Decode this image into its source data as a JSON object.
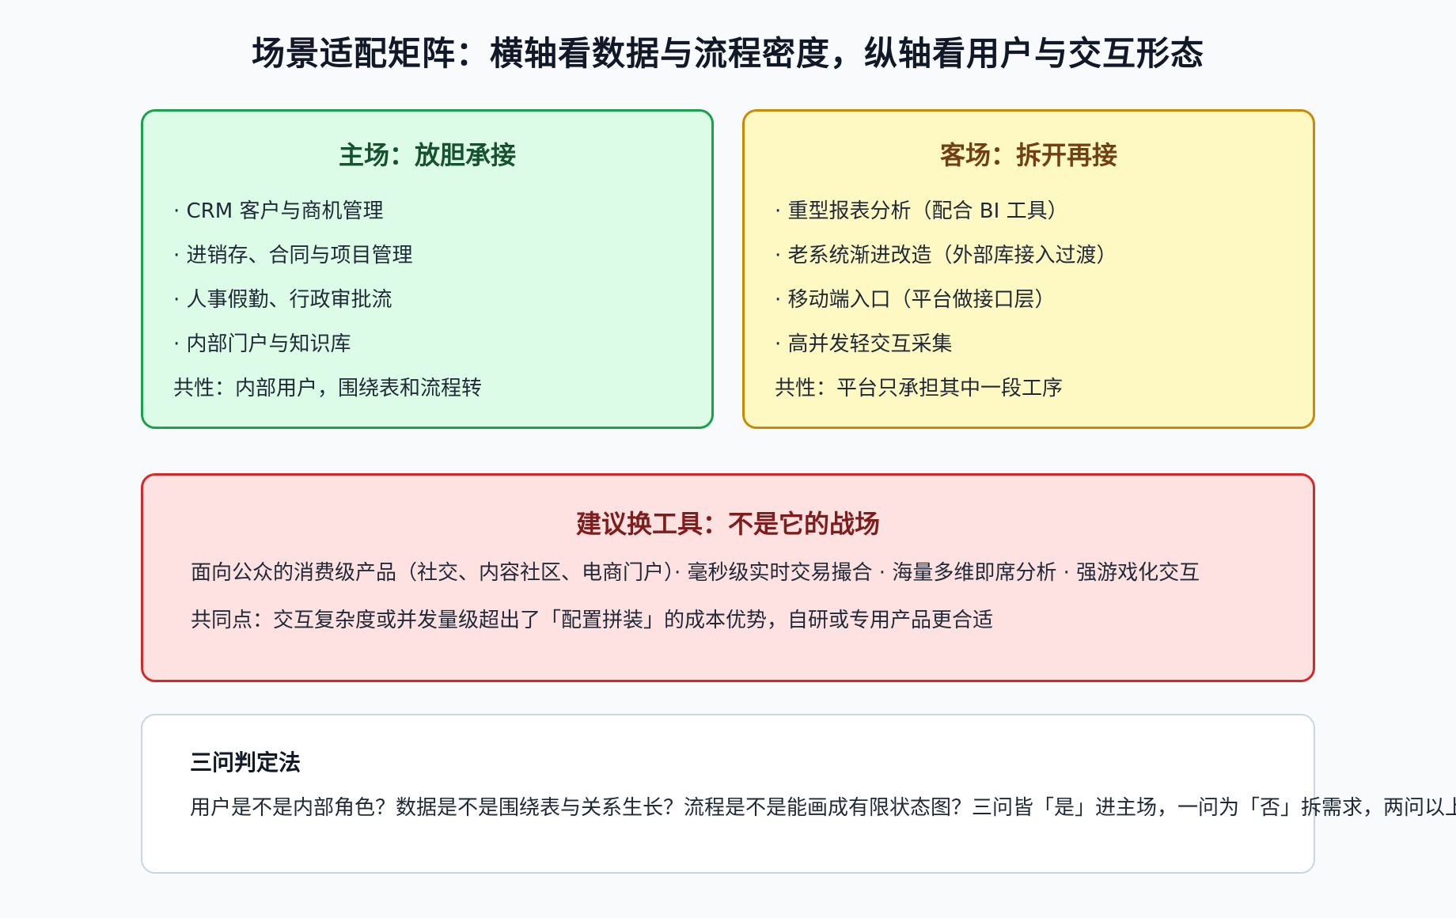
{
  "title": "场景适配矩阵：横轴看数据与流程密度，纵轴看用户与交互形态",
  "home": {
    "title": "主场：放胆承接",
    "items": [
      "· CRM 客户与商机管理",
      "· 进销存、合同与项目管理",
      "· 人事假勤、行政审批流",
      "· 内部门户与知识库"
    ],
    "summary": "共性：内部用户，围绕表和流程转"
  },
  "away": {
    "title": "客场：拆开再接",
    "items": [
      "· 重型报表分析（配合 BI 工具）",
      "· 老系统渐进改造（外部库接入过渡）",
      "· 移动端入口（平台做接口层）",
      "· 高并发轻交互采集"
    ],
    "summary": "共性：平台只承担其中一段工序"
  },
  "switch": {
    "title": "建议换工具：不是它的战场",
    "line1": "面向公众的消费级产品（社交、内容社区、电商门户）· 毫秒级实时交易撮合 · 海量多维即席分析 · 强游戏化交互",
    "line2": "共同点：交互复杂度或并发量级超出了「配置拼装」的成本优势，自研或专用产品更合适"
  },
  "test": {
    "heading": "三问判定法",
    "text": "用户是不是内部角色？数据是不是围绕表与关系生长？流程是不是能画成有限状态图？三问皆「是」进主场，一问为「否」拆需求，两问以上"
  },
  "colors": {
    "home_bg": "#dcfce7",
    "home_border": "#16a34a",
    "away_bg": "#fef9c3",
    "away_border": "#ca8a04",
    "switch_bg": "#fee2e2",
    "switch_border": "#dc2626"
  }
}
